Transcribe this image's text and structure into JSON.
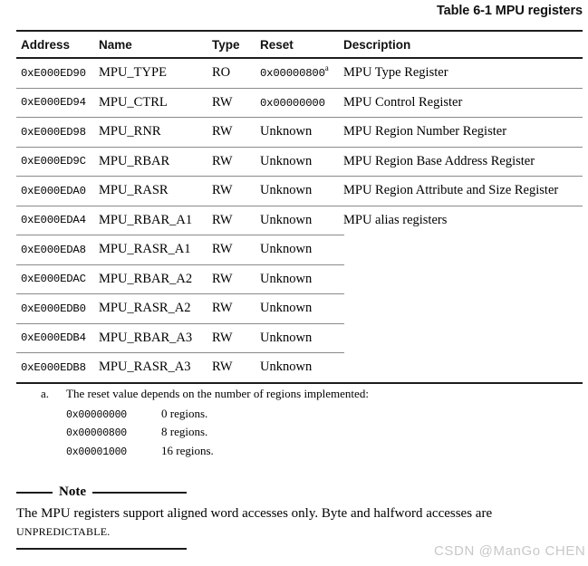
{
  "table": {
    "caption": "Table 6-1 MPU registers",
    "columns": [
      "Address",
      "Name",
      "Type",
      "Reset",
      "Description"
    ],
    "rows": [
      {
        "address": "0xE000ED90",
        "name": "MPU_TYPE",
        "type": "RO",
        "reset": "0x00000800",
        "reset_footnote": "a",
        "description": "MPU Type Register",
        "separator": "full"
      },
      {
        "address": "0xE000ED94",
        "name": "MPU_CTRL",
        "type": "RW",
        "reset": "0x00000000",
        "reset_footnote": "",
        "description": "MPU Control Register",
        "separator": "full"
      },
      {
        "address": "0xE000ED98",
        "name": "MPU_RNR",
        "type": "RW",
        "reset": "Unknown",
        "reset_footnote": "",
        "description": "MPU Region Number Register",
        "separator": "full"
      },
      {
        "address": "0xE000ED9C",
        "name": "MPU_RBAR",
        "type": "RW",
        "reset": "Unknown",
        "reset_footnote": "",
        "description": "MPU Region Base Address Register",
        "separator": "full"
      },
      {
        "address": "0xE000EDA0",
        "name": "MPU_RASR",
        "type": "RW",
        "reset": "Unknown",
        "reset_footnote": "",
        "description": "MPU Region Attribute and Size Register",
        "separator": "full"
      },
      {
        "address": "0xE000EDA4",
        "name": "MPU_RBAR_A1",
        "type": "RW",
        "reset": "Unknown",
        "reset_footnote": "",
        "description": "MPU alias registers",
        "separator": "short"
      },
      {
        "address": "0xE000EDA8",
        "name": "MPU_RASR_A1",
        "type": "RW",
        "reset": "Unknown",
        "reset_footnote": "",
        "description": "",
        "separator": "short"
      },
      {
        "address": "0xE000EDAC",
        "name": "MPU_RBAR_A2",
        "type": "RW",
        "reset": "Unknown",
        "reset_footnote": "",
        "description": "",
        "separator": "short"
      },
      {
        "address": "0xE000EDB0",
        "name": "MPU_RASR_A2",
        "type": "RW",
        "reset": "Unknown",
        "reset_footnote": "",
        "description": "",
        "separator": "short"
      },
      {
        "address": "0xE000EDB4",
        "name": "MPU_RBAR_A3",
        "type": "RW",
        "reset": "Unknown",
        "reset_footnote": "",
        "description": "",
        "separator": "short"
      },
      {
        "address": "0xE000EDB8",
        "name": "MPU_RASR_A3",
        "type": "RW",
        "reset": "Unknown",
        "reset_footnote": "",
        "description": "",
        "separator": "none"
      }
    ]
  },
  "footnote": {
    "marker": "a.",
    "text": "The reset value depends on the number of regions implemented:",
    "values": [
      {
        "value": "0x00000000",
        "label": "0 regions."
      },
      {
        "value": "0x00000800",
        "label": "8 regions."
      },
      {
        "value": "0x00001000",
        "label": "16 regions."
      }
    ]
  },
  "note": {
    "label": "Note",
    "body_line1": "The MPU registers support aligned word accesses only. Byte and halfword accesses are",
    "body_line2": "UNPREDICTABLE."
  },
  "watermark": {
    "text": "CSDN @ManGo CHEN",
    "color": "#c8c8c8"
  }
}
